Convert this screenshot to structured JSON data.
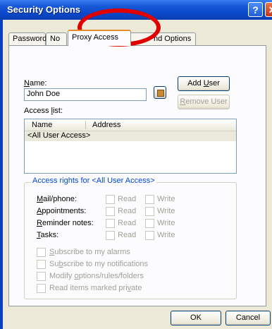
{
  "window": {
    "title": "Security Options",
    "help_glyph": "?",
    "close_glyph": "✕"
  },
  "tabs": [
    {
      "label": "Password"
    },
    {
      "label": "No"
    },
    {
      "label": "Proxy Access"
    },
    {
      "label": "nd Options"
    }
  ],
  "form": {
    "name_label_pre": "",
    "name_label_accel": "N",
    "name_label_post": "ame:",
    "name_value": "John Doe",
    "add_user_pre": "Add ",
    "add_user_accel": "U",
    "add_user_post": "ser",
    "remove_user_pre": "",
    "remove_user_accel": "R",
    "remove_user_post": "emove User",
    "access_list_pre": "Access ",
    "access_list_accel": "l",
    "access_list_post": "ist:"
  },
  "access_list": {
    "columns": [
      "Name",
      "Address"
    ],
    "rows": [
      {
        "name": "<All User Access>",
        "address": ""
      }
    ]
  },
  "rights": {
    "group_title": "Access rights for <All User Access>",
    "rows": [
      {
        "pre": "",
        "accel": "M",
        "post": "ail/phone:",
        "read": "Read",
        "write": "Write"
      },
      {
        "pre": "",
        "accel": "A",
        "post": "ppointments:",
        "read": "Read",
        "write": "Write"
      },
      {
        "pre": "",
        "accel": "R",
        "post": "eminder notes:",
        "read": "Read",
        "write": "Write"
      },
      {
        "pre": "",
        "accel": "T",
        "post": "asks:",
        "read": "Read",
        "write": "Write"
      }
    ],
    "options": [
      {
        "pre": "",
        "accel": "S",
        "post": "ubscribe to my alarms"
      },
      {
        "pre": "Su",
        "accel": "b",
        "post": "scribe to my notifications"
      },
      {
        "pre": "Modify ",
        "accel": "o",
        "post": "ptions/rules/folders"
      },
      {
        "pre": "Read items marked pri",
        "accel": "v",
        "post": "ate"
      }
    ]
  },
  "footer": {
    "ok_label": "OK",
    "cancel_label": "Cancel"
  }
}
